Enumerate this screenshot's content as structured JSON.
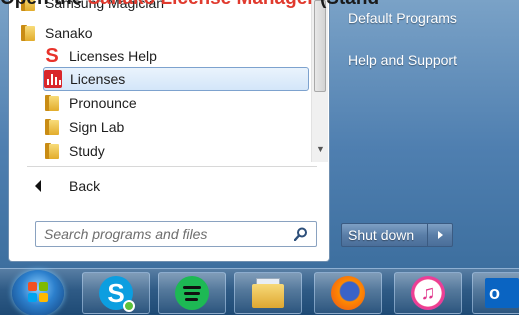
{
  "caption": {
    "part1": "Open the ",
    "part2": "Sanako License Manager",
    "part3": " (Stand"
  },
  "start_menu": {
    "programs": [
      {
        "label": "Samsung Magician",
        "kind": "folder"
      },
      {
        "label": "Sanako",
        "kind": "folder"
      },
      {
        "label": "Licenses Help",
        "kind": "s-logo"
      },
      {
        "label": "Licenses",
        "kind": "licenses-app",
        "selected": true
      },
      {
        "label": "Pronounce",
        "kind": "folder"
      },
      {
        "label": "Sign Lab",
        "kind": "folder"
      },
      {
        "label": "Study",
        "kind": "folder"
      }
    ],
    "back_label": "Back",
    "search": {
      "placeholder": "Search programs and files",
      "value": ""
    },
    "right_items": [
      {
        "label": "Default Programs"
      },
      {
        "label": "Help and Support"
      }
    ],
    "shutdown_label": "Shut down"
  },
  "taskbar": {
    "apps": [
      "skype",
      "spotify",
      "windows-explorer",
      "firefox",
      "itunes",
      "outlook"
    ]
  },
  "colors": {
    "accent_red": "#e03a2e",
    "selection": "#d4e6f9",
    "menu_blue": "#4f7fb0"
  }
}
